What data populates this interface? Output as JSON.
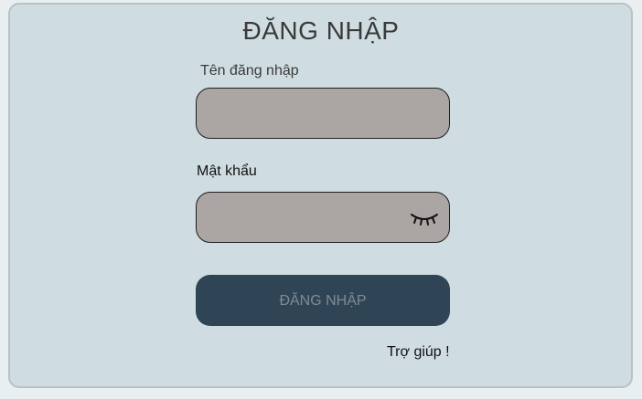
{
  "title": "ĐĂNG NHẬP",
  "username": {
    "label": "Tên đăng nhập",
    "value": ""
  },
  "password": {
    "label": "Mật khẩu",
    "value": "",
    "toggle_icon": "eye-closed-icon"
  },
  "login_button": {
    "label": "ĐĂNG NHẬP"
  },
  "help_link": {
    "label": "Trợ giúp !"
  },
  "colors": {
    "panel_bg": "#cfdde3",
    "field_bg": "#aba5a3",
    "button_bg": "#2f4556",
    "button_text": "#7f8b94"
  }
}
